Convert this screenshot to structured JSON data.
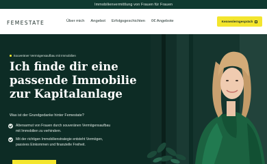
{
  "topbar": {
    "text": "Immobilienvermittlung von Frauen für Frauen"
  },
  "nav": {
    "logo": "FEMESTATE",
    "items": [
      "Über mich",
      "Angebot",
      "Erfolgsgeschichten",
      "0€ Angebote"
    ],
    "cta_label": "Kennenlerngespräch"
  },
  "hero": {
    "eyebrow": "Souveräner Vermögensaufbau mit Immobilien",
    "headline": [
      "Ich finde dir eine",
      "passende Immobilie",
      "zur Kapitalanlage"
    ],
    "question": "Was ist der Grundgedanke hinter Femestate?",
    "bullets": [
      [
        "Altersarmut von Frauen durch souveränen Vermögensaufbau",
        "mit Immobilien zu verhindern."
      ],
      [
        "Mit der richtigen Immobilienstrategie entsteht Vermögen,",
        "passives Einkommen und finanzielle Freiheit."
      ]
    ]
  },
  "colors": {
    "accent": "#f3e52d",
    "dark_green": "#0f3a30",
    "emerald": "#1d6b47"
  },
  "icons": {
    "cta": "calendar-icon",
    "bullet": "check-circle-icon",
    "eyebrow": "yellow-dot"
  }
}
